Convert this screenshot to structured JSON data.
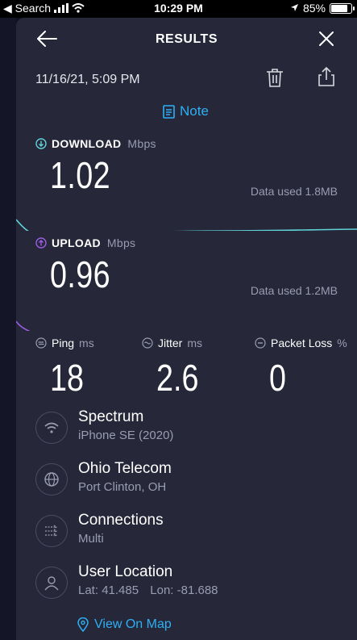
{
  "status_bar": {
    "carrier": "◀ Search",
    "time": "10:29 PM",
    "battery": "85%",
    "battery_level": 0.85
  },
  "header": {
    "title": "RESULTS"
  },
  "result": {
    "datetime": "11/16/21, 5:09 PM",
    "note_label": "Note"
  },
  "download": {
    "label": "DOWNLOAD",
    "unit": "Mbps",
    "value": "1.02",
    "data_used": "Data used 1.8MB",
    "color": "#5fd3d9"
  },
  "upload": {
    "label": "UPLOAD",
    "unit": "Mbps",
    "value": "0.96",
    "data_used": "Data used 1.2MB",
    "color": "#9b5de5"
  },
  "stats": {
    "ping": {
      "label": "Ping",
      "unit": "ms",
      "value": "18"
    },
    "jitter": {
      "label": "Jitter",
      "unit": "ms",
      "value": "2.6"
    },
    "packet_loss": {
      "label": "Packet Loss",
      "unit": "%",
      "value": "0"
    }
  },
  "info": [
    {
      "title": "Spectrum",
      "subtitle": "iPhone SE (2020)",
      "icon": "wifi-icon"
    },
    {
      "title": "Ohio Telecom",
      "subtitle": "Port Clinton, OH",
      "icon": "globe-icon"
    },
    {
      "title": "Connections",
      "subtitle": "Multi",
      "icon": "connections-icon"
    },
    {
      "title": "User Location",
      "lat_label": "Lat:",
      "lat": "41.485",
      "lon_label": "Lon:",
      "lon": "-81.688",
      "icon": "user-icon"
    }
  ],
  "map_link": "View On Map",
  "colors": {
    "accent": "#2eb0f5",
    "card": "#262738",
    "muted": "#9a9cb0"
  }
}
